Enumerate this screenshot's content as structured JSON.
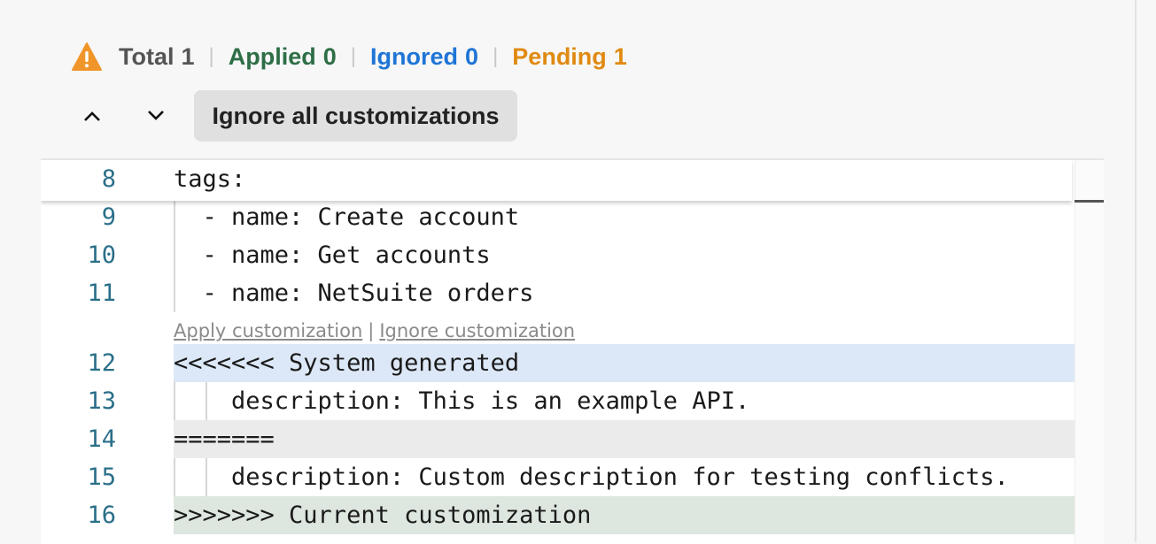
{
  "summary": {
    "total_label": "Total",
    "total_count": "1",
    "applied_label": "Applied",
    "applied_count": "0",
    "ignored_label": "Ignored",
    "ignored_count": "0",
    "pending_label": "Pending",
    "pending_count": "1",
    "separator": "|"
  },
  "icons": {
    "warning": "warning-triangle-icon",
    "up": "chevron-up-icon",
    "down": "chevron-down-icon"
  },
  "colors": {
    "applied": "#2e6e46",
    "ignored": "#1f75d6",
    "pending": "#e08a12",
    "warning": "#f0952a"
  },
  "toolbar": {
    "ignore_all_label": "Ignore all customizations"
  },
  "editor": {
    "sticky": {
      "num": "8",
      "text": "tags:"
    },
    "lines": [
      {
        "num": "9",
        "text": "  - name: Create account"
      },
      {
        "num": "10",
        "text": "  - name: Get accounts"
      },
      {
        "num": "11",
        "text": "  - name: NetSuite orders"
      },
      {
        "num": "12",
        "text": "<<<<<<< System generated"
      },
      {
        "num": "13",
        "text": "    description: This is an example API."
      },
      {
        "num": "14",
        "text": "======="
      },
      {
        "num": "15",
        "text": "    description: Custom description for testing conflicts."
      },
      {
        "num": "16",
        "text": ">>>>>>> Current customization"
      }
    ],
    "actions": {
      "apply": "Apply customization",
      "separator": "|",
      "ignore": "Ignore customization"
    }
  }
}
